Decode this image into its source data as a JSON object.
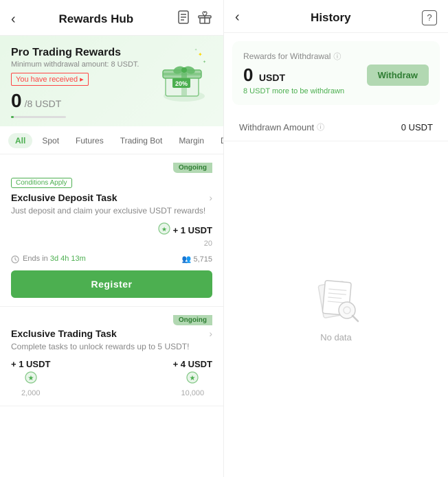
{
  "left": {
    "back_label": "‹",
    "title": "Rewards Hub",
    "icon1": "🗂",
    "icon2": "🎁",
    "hero": {
      "title": "Pro Trading Rewards",
      "subtitle": "Minimum withdrawal amount: 8 USDT.",
      "received_label": "You have received ▸",
      "amount": "0",
      "amount_unit": "/8 USDT"
    },
    "filter_tabs": [
      {
        "label": "All",
        "active": true
      },
      {
        "label": "Spot",
        "active": false
      },
      {
        "label": "Futures",
        "active": false
      },
      {
        "label": "Trading Bot",
        "active": false
      },
      {
        "label": "Margin",
        "active": false
      },
      {
        "label": "Deposit/Add",
        "active": false
      }
    ],
    "task1": {
      "ongoing_badge": "Ongoing",
      "conditions_tag": "Conditions Apply",
      "title": "Exclusive Deposit Task",
      "desc": "Just deposit and claim your exclusive USDT rewards!",
      "reward_amount": "+ 1 USDT",
      "reward_count": "20",
      "time_label": "Ends in",
      "time_value": "3d 4h 13m",
      "users_icon": "👥",
      "users_count": "5,715",
      "register_btn": "Register"
    },
    "task2": {
      "ongoing_badge": "Ongoing",
      "title": "Exclusive Trading Task",
      "desc": "Complete tasks to unlock rewards up to 5 USDT!",
      "reward1_amount": "+ 1 USDT",
      "reward1_count": "2,000",
      "reward2_amount": "+ 4 USDT",
      "reward2_count": "10,000"
    }
  },
  "right": {
    "back_label": "‹",
    "title": "History",
    "help_icon": "?",
    "rewards_label": "Rewards for Withdrawal",
    "rewards_amount": "0",
    "rewards_unit": "USDT",
    "rewards_sub": "8 USDT more to be withdrawn",
    "withdraw_btn": "Withdraw",
    "withdrawn_label": "Withdrawn Amount",
    "withdrawn_value": "0 USDT",
    "no_data": "No data"
  }
}
